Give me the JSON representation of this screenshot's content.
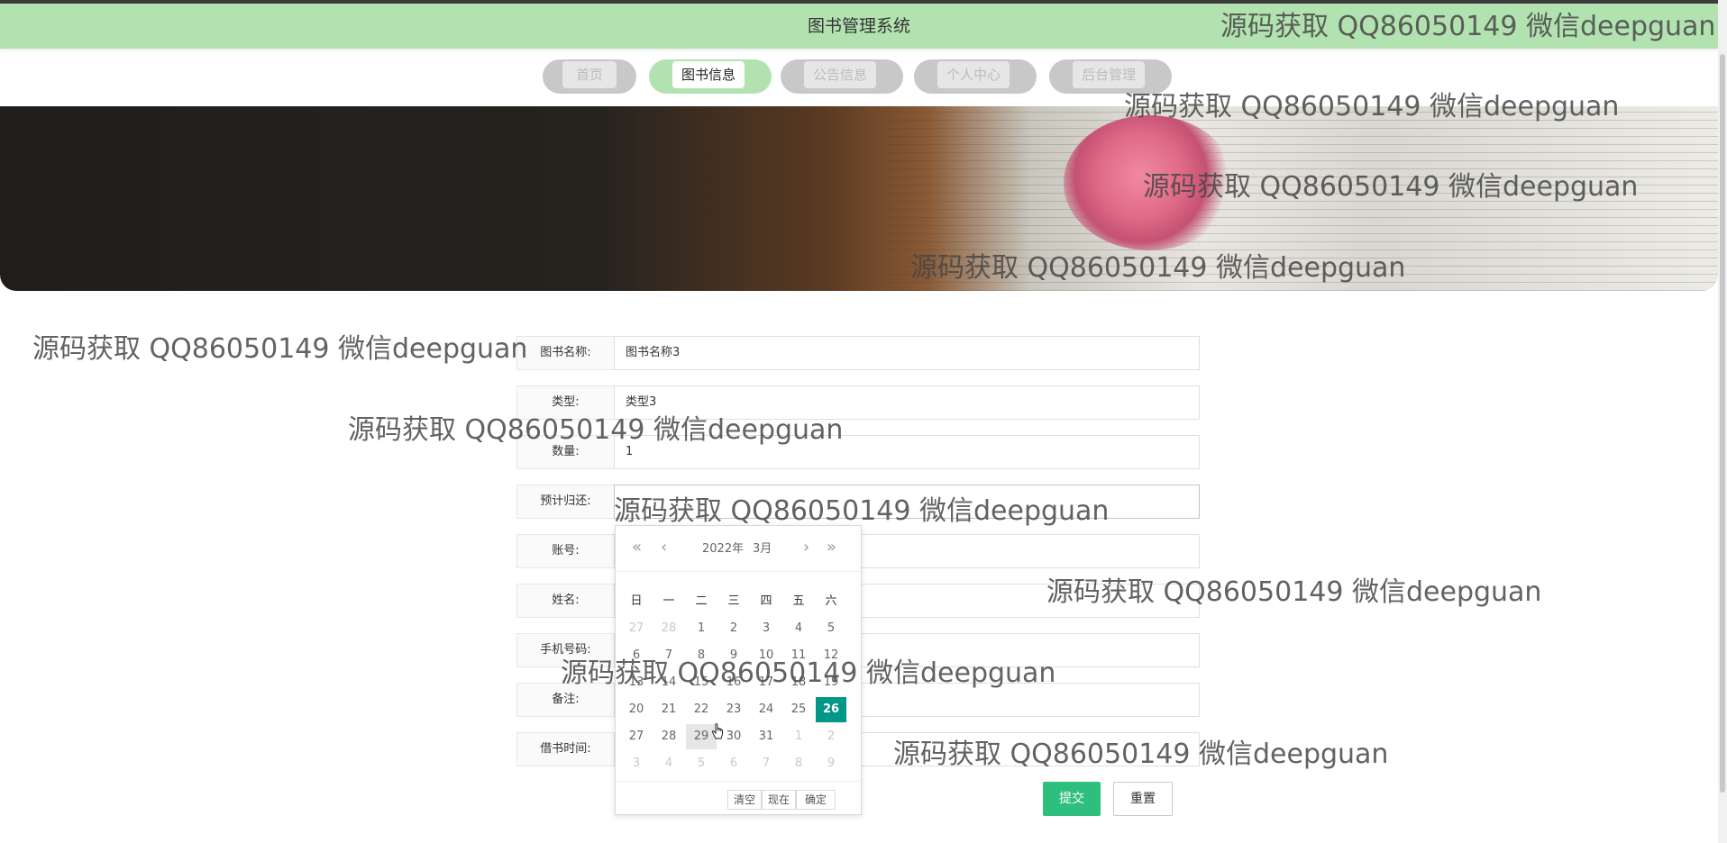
{
  "header": {
    "title": "图书管理系统"
  },
  "nav": {
    "items": [
      {
        "label": "首页",
        "active": false
      },
      {
        "label": "图书信息",
        "active": true
      },
      {
        "label": "公告信息",
        "active": false
      },
      {
        "label": "个人中心",
        "active": false
      },
      {
        "label": "后台管理",
        "active": false
      }
    ]
  },
  "form": {
    "rows": [
      {
        "label": "图书名称:",
        "value": "图书名称3"
      },
      {
        "label": "类型:",
        "value": "类型3"
      },
      {
        "label": "数量:",
        "value": "1"
      },
      {
        "label": "预计归还:",
        "value": ""
      },
      {
        "label": "账号:",
        "value": ""
      },
      {
        "label": "姓名:",
        "value": ""
      },
      {
        "label": "手机号码:",
        "value": ""
      },
      {
        "label": "备注:",
        "value": ""
      },
      {
        "label": "借书时间:",
        "value": ""
      }
    ],
    "submit_label": "提交",
    "reset_label": "重置"
  },
  "datepicker": {
    "year_label": "2022年",
    "month_label": "3月",
    "weekdays": [
      "日",
      "一",
      "二",
      "三",
      "四",
      "五",
      "六"
    ],
    "weeks": [
      [
        "27",
        "28",
        "1",
        "2",
        "3",
        "4",
        "5"
      ],
      [
        "6",
        "7",
        "8",
        "9",
        "10",
        "11",
        "12"
      ],
      [
        "13",
        "14",
        "15",
        "16",
        "17",
        "18",
        "19"
      ],
      [
        "20",
        "21",
        "22",
        "23",
        "24",
        "25",
        "26"
      ],
      [
        "27",
        "28",
        "29",
        "30",
        "31",
        "1",
        "2"
      ],
      [
        "3",
        "4",
        "5",
        "6",
        "7",
        "8",
        "9"
      ]
    ],
    "selected_day": "26",
    "hovered_day": "29",
    "clear_label": "清空",
    "now_label": "现在",
    "confirm_label": "确定"
  },
  "watermark": {
    "text": "源码获取 QQ86050149 微信deepguan"
  },
  "colors": {
    "header_bg": "#b3e2b1",
    "accent": "#2ebf7f",
    "selected_day": "#009688"
  },
  "icons": [
    "prev-year-icon",
    "prev-month-icon",
    "next-month-icon",
    "next-year-icon",
    "hand-cursor-icon"
  ]
}
